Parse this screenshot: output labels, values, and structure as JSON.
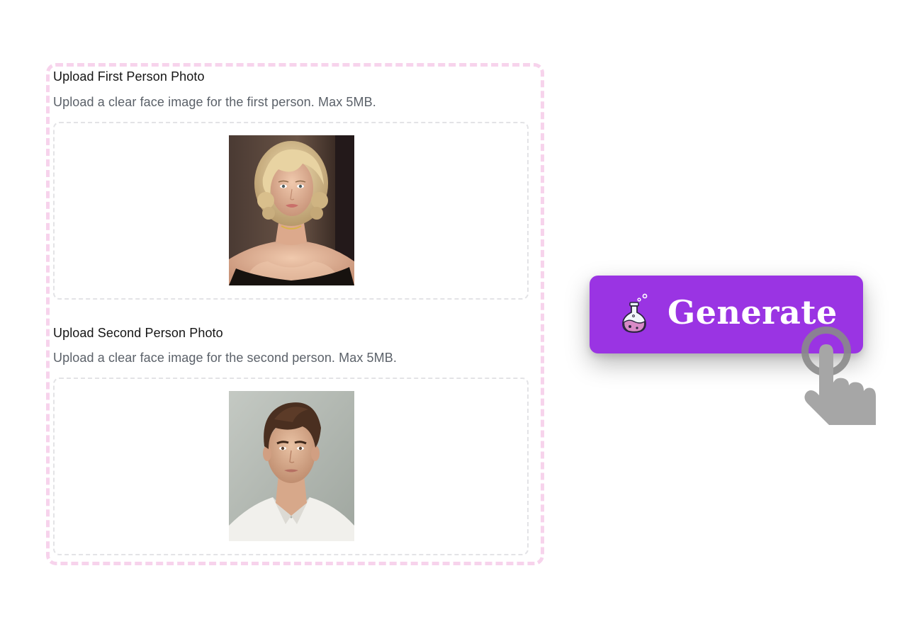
{
  "uploads": [
    {
      "title": "Upload First Person Photo",
      "description": "Upload a clear face image for the first person. Max 5MB.",
      "photo": "portrait-woman-blonde"
    },
    {
      "title": "Upload Second Person Photo",
      "description": "Upload a clear face image for the second person. Max 5MB.",
      "photo": "portrait-man-brunette"
    }
  ],
  "generate": {
    "label": "Generate",
    "icon": "flask-icon",
    "color": "#9a34e3"
  },
  "cursor": {
    "icon": "hand-pointer-icon"
  },
  "colors": {
    "card_border": "#f7d3ec",
    "dropzone_border": "#e3e3e6"
  }
}
